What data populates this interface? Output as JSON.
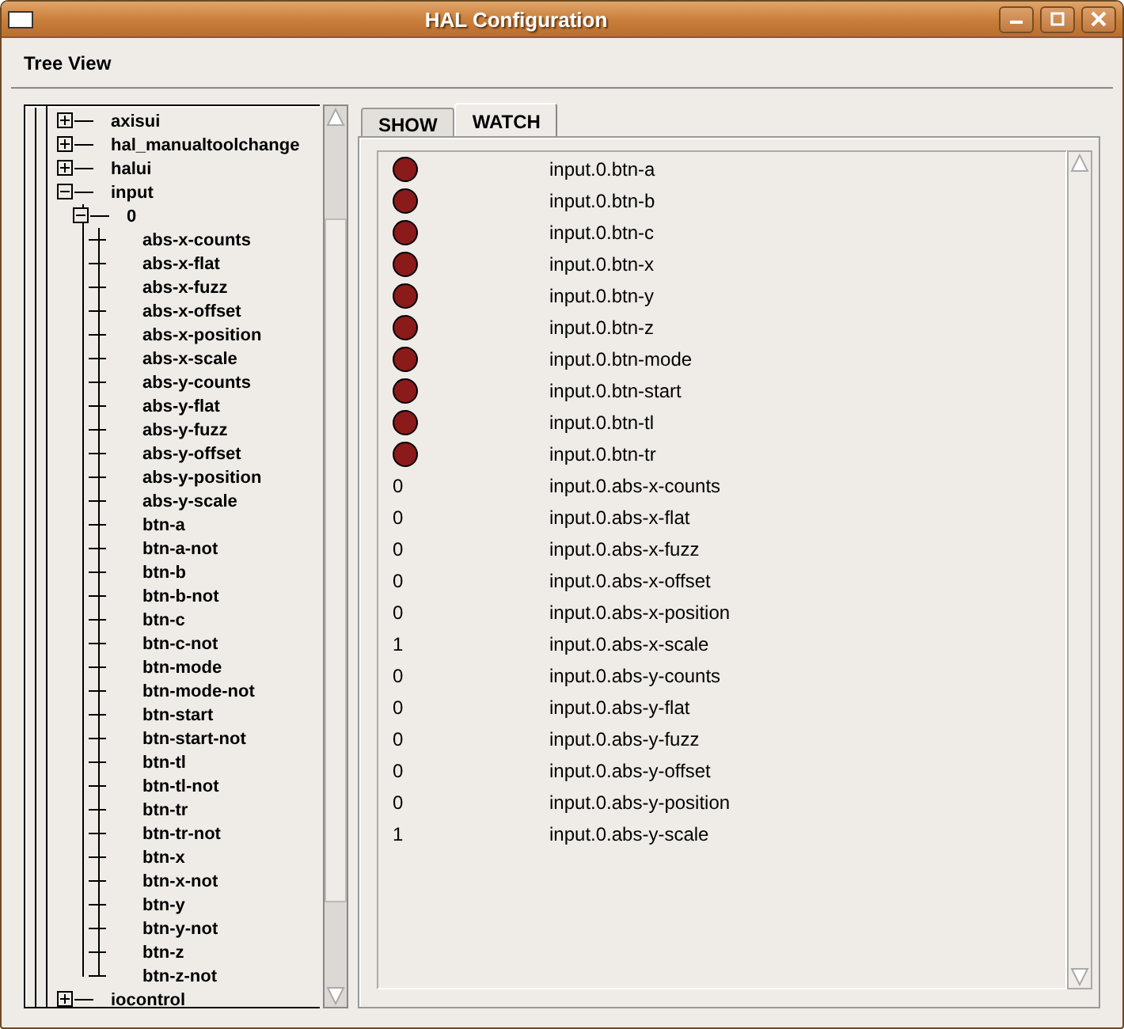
{
  "window": {
    "title": "HAL Configuration"
  },
  "menu": {
    "label": "Tree View"
  },
  "tree": [
    {
      "label": "axisui",
      "expanded": false
    },
    {
      "label": "hal_manualtoolchange",
      "expanded": false
    },
    {
      "label": "halui",
      "expanded": false
    },
    {
      "label": "input",
      "expanded": true,
      "children": [
        {
          "label": "0",
          "expanded": true,
          "children": [
            {
              "label": "abs-x-counts"
            },
            {
              "label": "abs-x-flat"
            },
            {
              "label": "abs-x-fuzz"
            },
            {
              "label": "abs-x-offset"
            },
            {
              "label": "abs-x-position"
            },
            {
              "label": "abs-x-scale"
            },
            {
              "label": "abs-y-counts"
            },
            {
              "label": "abs-y-flat"
            },
            {
              "label": "abs-y-fuzz"
            },
            {
              "label": "abs-y-offset"
            },
            {
              "label": "abs-y-position"
            },
            {
              "label": "abs-y-scale"
            },
            {
              "label": "btn-a"
            },
            {
              "label": "btn-a-not"
            },
            {
              "label": "btn-b"
            },
            {
              "label": "btn-b-not"
            },
            {
              "label": "btn-c"
            },
            {
              "label": "btn-c-not"
            },
            {
              "label": "btn-mode"
            },
            {
              "label": "btn-mode-not"
            },
            {
              "label": "btn-start"
            },
            {
              "label": "btn-start-not"
            },
            {
              "label": "btn-tl"
            },
            {
              "label": "btn-tl-not"
            },
            {
              "label": "btn-tr"
            },
            {
              "label": "btn-tr-not"
            },
            {
              "label": "btn-x"
            },
            {
              "label": "btn-x-not"
            },
            {
              "label": "btn-y"
            },
            {
              "label": "btn-y-not"
            },
            {
              "label": "btn-z"
            },
            {
              "label": "btn-z-not"
            }
          ]
        }
      ]
    },
    {
      "label": "iocontrol",
      "expanded": false
    }
  ],
  "tabs": [
    {
      "label": "SHOW",
      "selected": false
    },
    {
      "label": "WATCH",
      "selected": true
    }
  ],
  "watch": [
    {
      "kind": "led",
      "on": false,
      "name": "input.0.btn-a"
    },
    {
      "kind": "led",
      "on": false,
      "name": "input.0.btn-b"
    },
    {
      "kind": "led",
      "on": false,
      "name": "input.0.btn-c"
    },
    {
      "kind": "led",
      "on": false,
      "name": "input.0.btn-x"
    },
    {
      "kind": "led",
      "on": false,
      "name": "input.0.btn-y"
    },
    {
      "kind": "led",
      "on": false,
      "name": "input.0.btn-z"
    },
    {
      "kind": "led",
      "on": false,
      "name": "input.0.btn-mode"
    },
    {
      "kind": "led",
      "on": false,
      "name": "input.0.btn-start"
    },
    {
      "kind": "led",
      "on": false,
      "name": "input.0.btn-tl"
    },
    {
      "kind": "led",
      "on": false,
      "name": "input.0.btn-tr"
    },
    {
      "kind": "value",
      "value": "0",
      "name": "input.0.abs-x-counts"
    },
    {
      "kind": "value",
      "value": "0",
      "name": "input.0.abs-x-flat"
    },
    {
      "kind": "value",
      "value": "0",
      "name": "input.0.abs-x-fuzz"
    },
    {
      "kind": "value",
      "value": "0",
      "name": "input.0.abs-x-offset"
    },
    {
      "kind": "value",
      "value": "0",
      "name": "input.0.abs-x-position"
    },
    {
      "kind": "value",
      "value": "1",
      "name": "input.0.abs-x-scale"
    },
    {
      "kind": "value",
      "value": "0",
      "name": "input.0.abs-y-counts"
    },
    {
      "kind": "value",
      "value": "0",
      "name": "input.0.abs-y-flat"
    },
    {
      "kind": "value",
      "value": "0",
      "name": "input.0.abs-y-fuzz"
    },
    {
      "kind": "value",
      "value": "0",
      "name": "input.0.abs-y-offset"
    },
    {
      "kind": "value",
      "value": "0",
      "name": "input.0.abs-y-position"
    },
    {
      "kind": "value",
      "value": "1",
      "name": "input.0.abs-y-scale"
    }
  ]
}
